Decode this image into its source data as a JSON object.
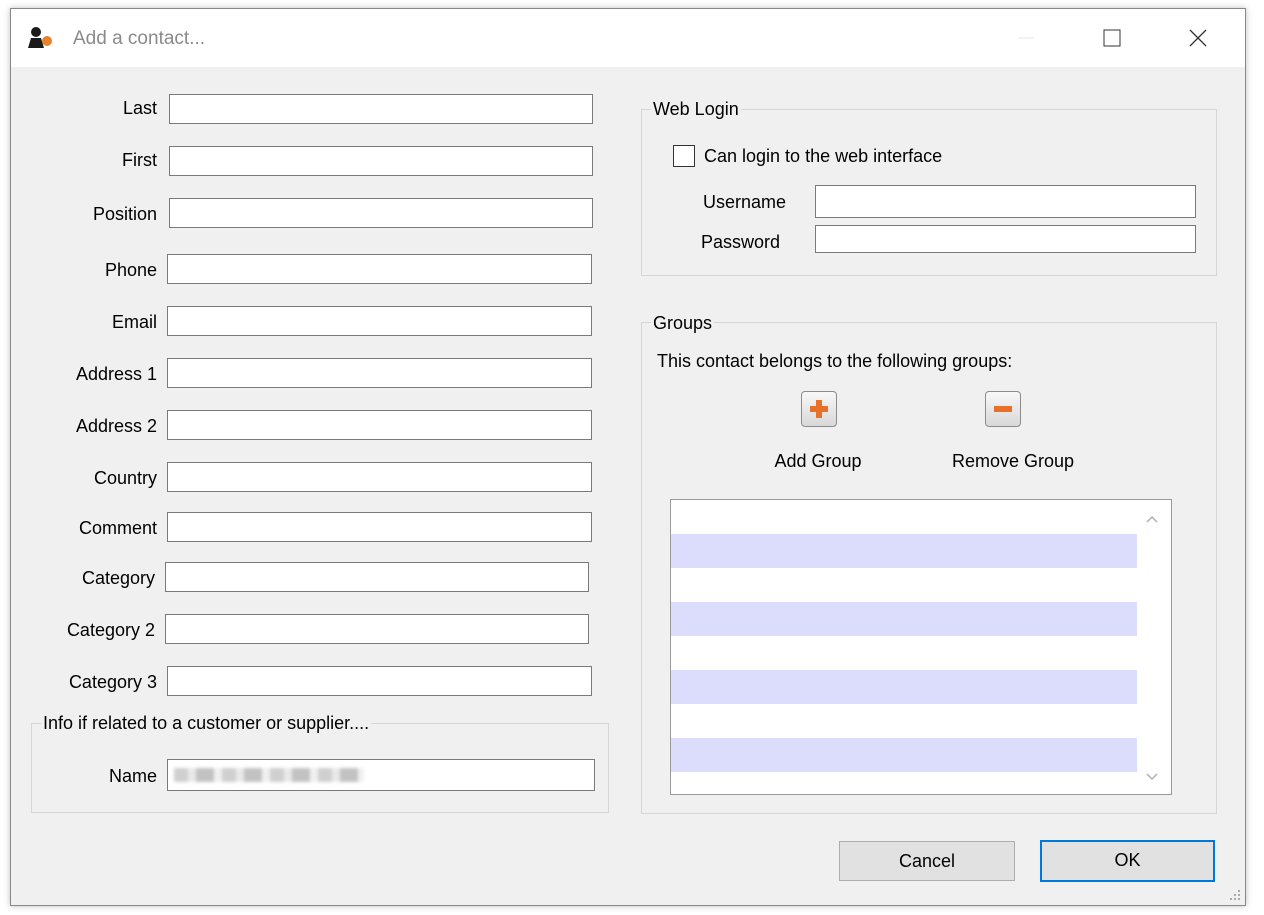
{
  "window": {
    "title": "Add a contact...",
    "accent_color": "#0078d7"
  },
  "form": {
    "fields": [
      {
        "label": "Last",
        "value": ""
      },
      {
        "label": "First",
        "value": ""
      },
      {
        "label": "Position",
        "value": ""
      },
      {
        "label": "Phone",
        "value": ""
      },
      {
        "label": "Email",
        "value": ""
      },
      {
        "label": "Address 1",
        "value": ""
      },
      {
        "label": "Address 2",
        "value": ""
      },
      {
        "label": "Country",
        "value": ""
      },
      {
        "label": "Comment",
        "value": ""
      },
      {
        "label": "Category",
        "value": ""
      },
      {
        "label": "Category 2",
        "value": ""
      },
      {
        "label": "Category 3",
        "value": ""
      }
    ]
  },
  "related": {
    "title": "Info if related to a customer or supplier....",
    "name_label": "Name",
    "name_value": ""
  },
  "web_login": {
    "title": "Web Login",
    "can_login_label": "Can login to the web interface",
    "can_login_checked": false,
    "username_label": "Username",
    "username_value": "",
    "password_label": "Password",
    "password_value": ""
  },
  "groups": {
    "title": "Groups",
    "description": "This contact belongs to the following groups:",
    "add_label": "Add Group",
    "remove_label": "Remove Group",
    "add_icon": "plus-icon",
    "remove_icon": "minus-icon",
    "list_items": [],
    "row_alt_color": "#dcdcfc"
  },
  "buttons": {
    "cancel_label": "Cancel",
    "ok_label": "OK"
  }
}
